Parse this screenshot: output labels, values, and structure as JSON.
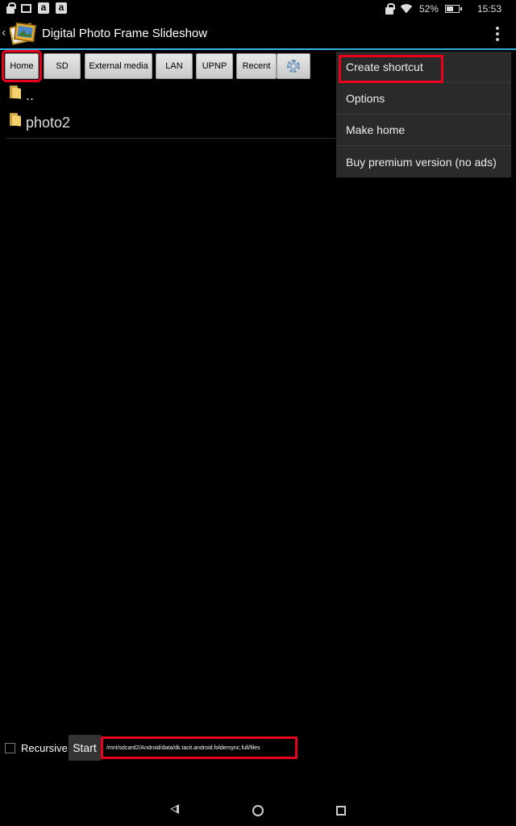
{
  "status_bar": {
    "battery": "52%",
    "time": "15:53",
    "notification_icons": [
      "lock-icon",
      "image-icon",
      "amazon-icon",
      "amazon-icon"
    ],
    "status_icons": [
      "lock-icon",
      "wifi-icon",
      "battery-icon"
    ]
  },
  "app": {
    "title": "Digital Photo Frame Slideshow",
    "accent_color": "#33b5e5",
    "highlight_color": "#e8001c"
  },
  "toolbar": {
    "buttons": [
      {
        "label": "Home",
        "highlighted": true
      },
      {
        "label": "SD"
      },
      {
        "label": "External media"
      },
      {
        "label": "LAN"
      },
      {
        "label": "UPNP"
      },
      {
        "label": "Recent"
      }
    ],
    "settings_icon": "gear-icon"
  },
  "files": [
    {
      "name": "..",
      "icon": "folder-icon"
    },
    {
      "name": "photo2",
      "icon": "folder-icon"
    }
  ],
  "menu": {
    "items": [
      {
        "label": "Create shortcut",
        "highlighted": true
      },
      {
        "label": "Options"
      },
      {
        "label": "Make home"
      },
      {
        "label": "Buy premium version (no ads)"
      }
    ]
  },
  "bottom": {
    "recursive_label": "Recursive",
    "recursive_checked": false,
    "start_label": "Start",
    "path": "/mnt/sdcard2/Android/data/dk.tacit.android.foldersync.full/files"
  },
  "nav": {
    "icons": [
      "back-icon",
      "home-icon",
      "recents-icon"
    ]
  }
}
